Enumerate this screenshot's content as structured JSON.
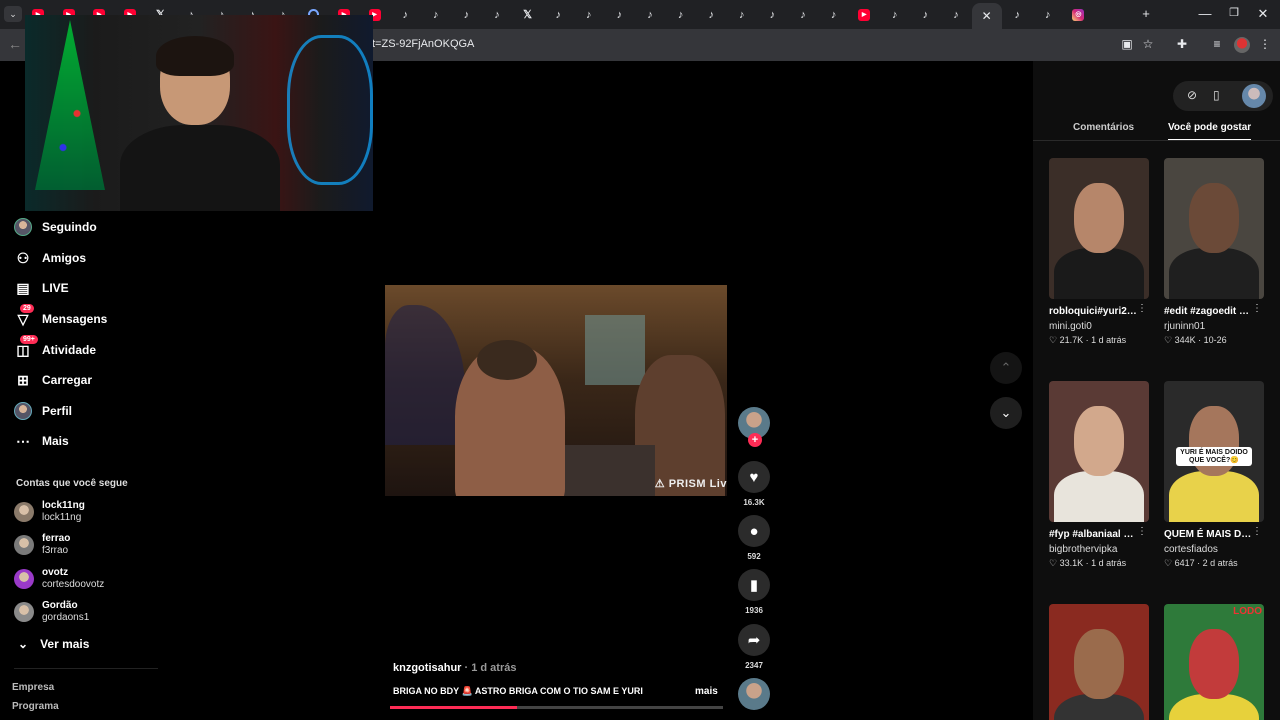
{
  "browser": {
    "url": "t=ZS-92FjAnOKQGA",
    "tab_icons": [
      "youtube-icon",
      "youtube-icon",
      "youtube-icon",
      "youtube-icon",
      "x-icon",
      "tiktok-icon",
      "tiktok-icon",
      "tiktok-icon",
      "tiktok-icon",
      "globe-icon",
      "youtube-icon",
      "youtube-icon",
      "tiktok-icon",
      "tiktok-icon",
      "tiktok-icon",
      "tiktok-icon",
      "x-icon",
      "tiktok-icon",
      "tiktok-icon",
      "tiktok-icon",
      "tiktok-icon",
      "tiktok-icon",
      "tiktok-icon",
      "tiktok-icon",
      "tiktok-icon",
      "tiktok-icon",
      "tiktok-icon",
      "youtube-icon",
      "tiktok-icon",
      "tiktok-icon",
      "tiktok-icon",
      "close-icon",
      "tiktok-icon",
      "tiktok-icon",
      "instagram-icon"
    ],
    "new_tab": "+",
    "window_buttons": [
      "—",
      "❐",
      "✕"
    ]
  },
  "sidebar": {
    "nav": [
      {
        "label": "Seguindo",
        "icon": "avatar-icon"
      },
      {
        "label": "Amigos",
        "icon": "friends-icon"
      },
      {
        "label": "LIVE",
        "icon": "live-icon"
      },
      {
        "label": "Mensagens",
        "icon": "messages-icon",
        "badge": "29"
      },
      {
        "label": "Atividade",
        "icon": "activity-icon",
        "badge": "99+"
      },
      {
        "label": "Carregar",
        "icon": "upload-icon"
      },
      {
        "label": "Perfil",
        "icon": "profile-icon"
      },
      {
        "label": "Mais",
        "icon": "more-icon"
      }
    ],
    "following_caption": "Contas que você segue",
    "following": [
      {
        "name": "lock11ng",
        "handle": "lock11ng",
        "color": "#8a7a6a"
      },
      {
        "name": "ferrao",
        "handle": "f3rrao",
        "color": "#7a7a7a"
      },
      {
        "name": "ovotz",
        "handle": "cortesdoovotz",
        "color": "#9a3ac8"
      },
      {
        "name": "Gordão",
        "handle": "gordaons1",
        "color": "#8a8a8a"
      }
    ],
    "see_more": "Ver mais",
    "footer": [
      "Empresa",
      "Programa"
    ]
  },
  "video": {
    "watermark": "⚠ PRISM Liv",
    "username": "knzgotisahur",
    "time": " · 1 d atrás",
    "caption": "BRIGA NO BDY 🚨 ASTRO BRIGA COM O TIO SAM E YURI",
    "more": "mais",
    "progress_fraction": 0.38,
    "actions": [
      {
        "icon": "heart-icon",
        "glyph": "♥",
        "count": "16.3K"
      },
      {
        "icon": "comment-icon",
        "glyph": "●",
        "count": "592"
      },
      {
        "icon": "bookmark-icon",
        "glyph": "▮",
        "count": "1936"
      },
      {
        "icon": "share-icon",
        "glyph": "➦",
        "count": "2347"
      }
    ],
    "follow_plus": "+"
  },
  "right_panel": {
    "tabs": [
      "Comentários",
      "Você pode gostar"
    ],
    "active_tab": 1,
    "cards": [
      {
        "title": "robloquici#yuri22 #foryou",
        "author": "mini.goti0",
        "likes": "21.7K",
        "time": "1 d atrás",
        "bg": "#3b2e28",
        "face": "#b6866a",
        "body": "#1a1a1a"
      },
      {
        "title": "#edit #zagoedit #zago #foryou...",
        "author": "rjuninn01",
        "likes": "344K",
        "time": "10-26",
        "bg": "#4a4640",
        "face": "#6b4a38",
        "body": "#1f1f1f"
      },
      {
        "title": "#fyp #albaniaal #kosova #bbvk...",
        "author": "bigbrothervipka",
        "likes": "33.1K",
        "time": "1 d atrás",
        "bg": "#5a3a35",
        "face": "#d2a88c",
        "body": "#e8e4dc"
      },
      {
        "title": "QUEM É MAIS DOIDO LUQUETA...",
        "author": "cortesfiados",
        "likes": "6417",
        "time": "2 d atrás",
        "bg": "#2a2a2a",
        "face": "#a5765c",
        "body": "#e8d24a",
        "overlay": "YURI É MAIS DOIDO QUE VOCÊ?😊"
      },
      {
        "title": "",
        "author": "",
        "likes": "",
        "time": "",
        "bg": "#8a2a20",
        "face": "#9a6b4c",
        "body": "#333"
      },
      {
        "title": "",
        "author": "",
        "likes": "",
        "time": "",
        "bg": "#2e7a3a",
        "face": "#c23b3b",
        "body": "#e7d13b",
        "logo": "LODO"
      }
    ]
  }
}
